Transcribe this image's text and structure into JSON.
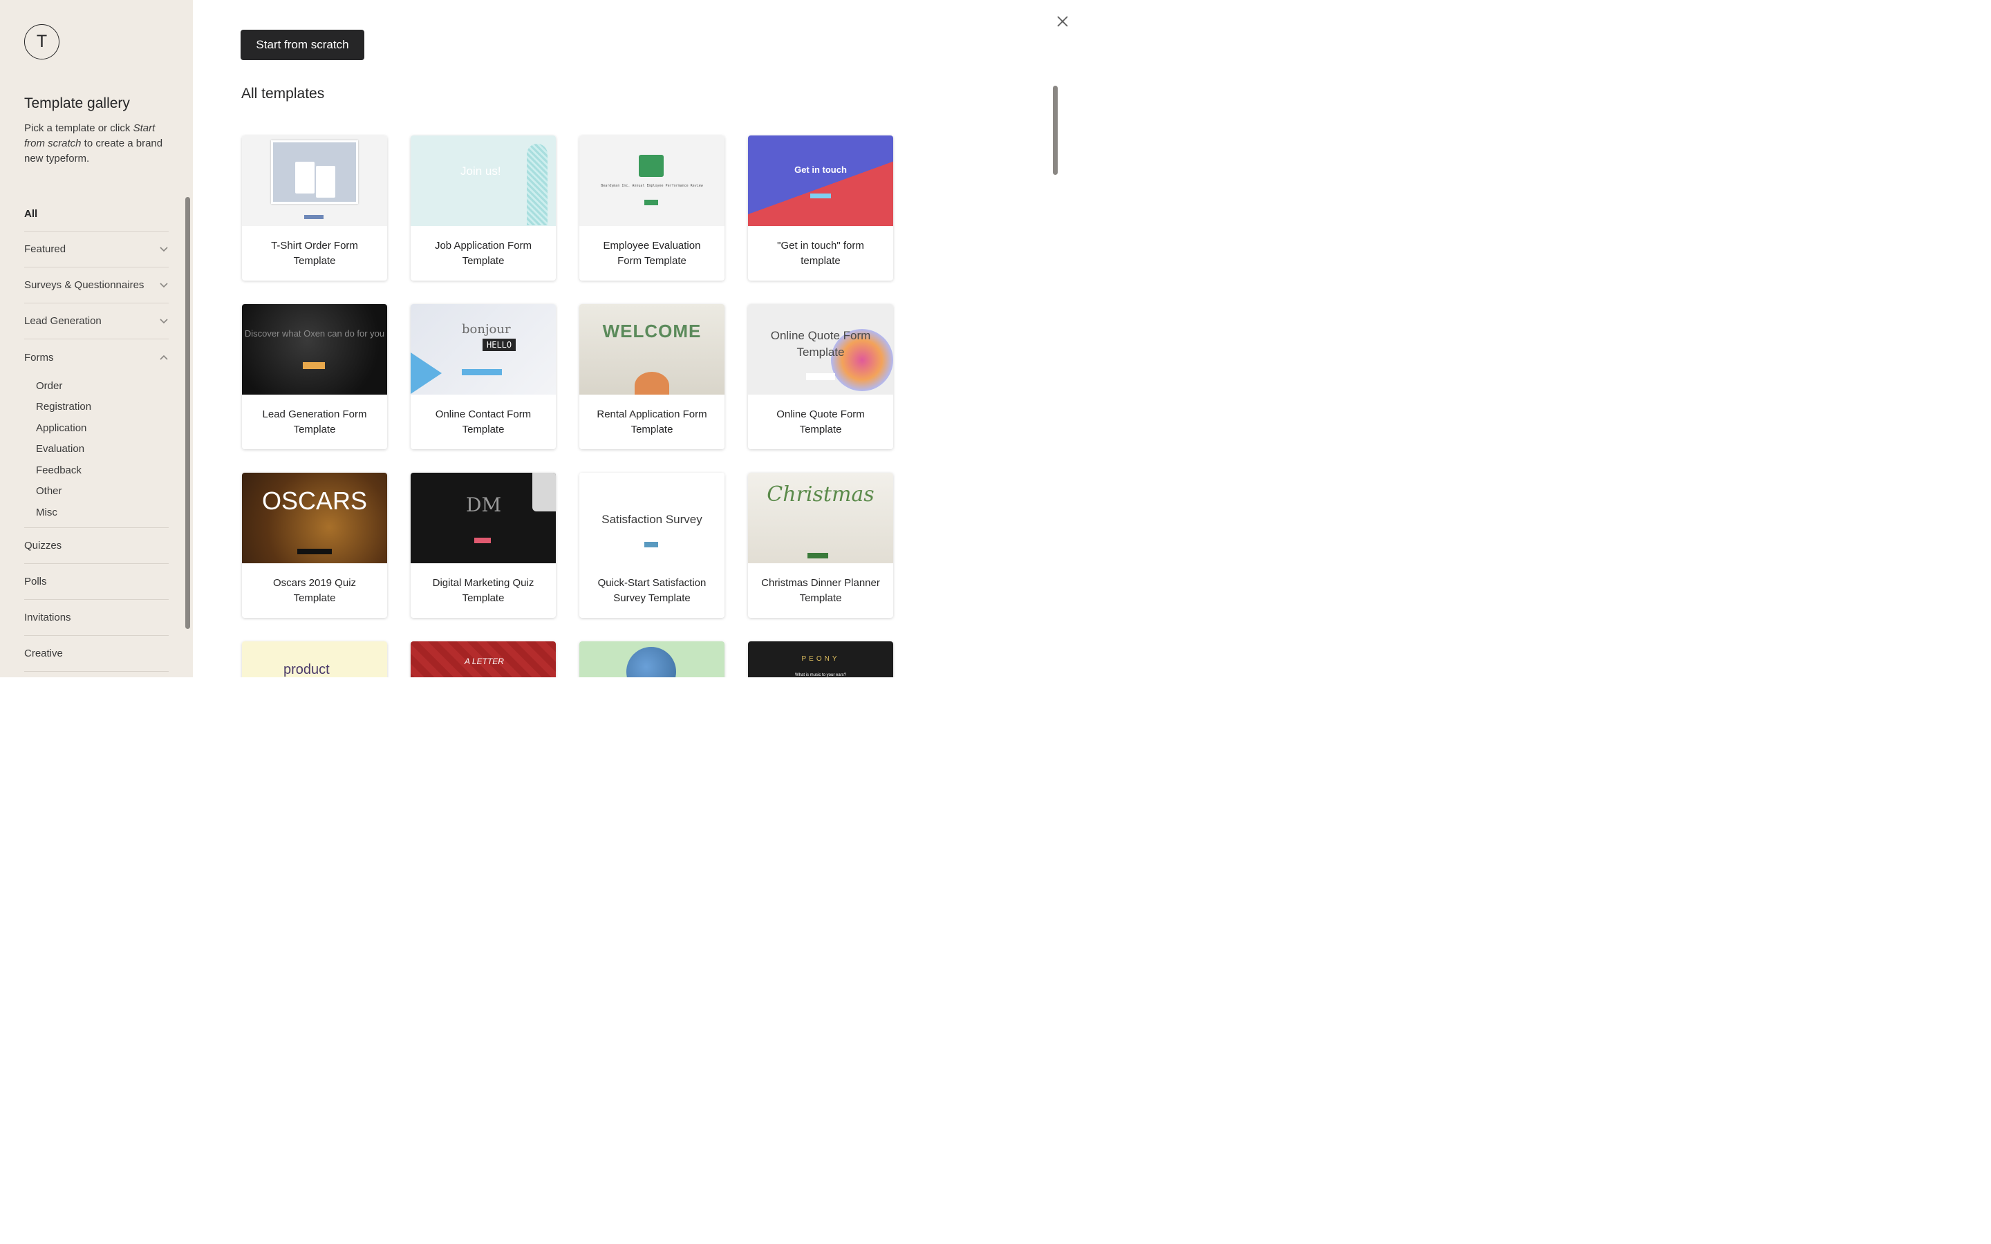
{
  "sidebar": {
    "avatar_letter": "T",
    "title": "Template gallery",
    "description": {
      "part1": "Pick a template or click ",
      "em": "Start from scratch",
      "part2": " to create a brand new typeform."
    },
    "categories": [
      {
        "label": "All",
        "active": true
      },
      {
        "label": "Featured",
        "chevron": "chevron-down"
      },
      {
        "label": "Surveys & Questionnaires",
        "chevron": "chevron-down"
      },
      {
        "label": "Lead Generation",
        "chevron": "chevron-down"
      },
      {
        "label": "Forms",
        "chevron": "chevron-up",
        "expanded": true,
        "subitems": [
          "Order",
          "Registration",
          "Application",
          "Evaluation",
          "Feedback",
          "Other",
          "Misc"
        ]
      },
      {
        "label": "Quizzes"
      },
      {
        "label": "Polls"
      },
      {
        "label": "Invitations"
      },
      {
        "label": "Creative"
      }
    ]
  },
  "main": {
    "start_button": "Start from scratch",
    "section_title": "All templates",
    "close_icon": "close-icon",
    "templates": [
      {
        "name": "T-Shirt Order Form Template",
        "thumb": "t1"
      },
      {
        "name": "Job Application Form Template",
        "thumb": "t2",
        "thumb_text": "Join us!"
      },
      {
        "name": "Employee Evaluation Form Template",
        "thumb": "t3",
        "thumb_text": "Beardyman Inc. Annual Employee Performance Review"
      },
      {
        "name": "\"Get in touch\" form template",
        "thumb": "t4",
        "thumb_text": "Get in touch"
      },
      {
        "name": "Lead Generation Form Template",
        "thumb": "t5",
        "thumb_text": "Discover what Oxen can do for you"
      },
      {
        "name": "Online Contact Form Template",
        "thumb": "t6",
        "thumb_text": "bonjour",
        "thumb_text2": "HELLO"
      },
      {
        "name": "Rental Application Form Template",
        "thumb": "t7",
        "thumb_text": "WELCOME"
      },
      {
        "name": "Online Quote Form Template",
        "thumb": "t8",
        "thumb_text": "Online Quote Form Template"
      },
      {
        "name": "Oscars 2019 Quiz Template",
        "thumb": "t9",
        "thumb_text": "OSCARS"
      },
      {
        "name": "Digital Marketing Quiz Template",
        "thumb": "t10",
        "thumb_text": "DM"
      },
      {
        "name": "Quick-Start Satisfaction Survey Template",
        "thumb": "t11",
        "thumb_text": "Satisfaction Survey"
      },
      {
        "name": "Christmas Dinner Planner Template",
        "thumb": "t12",
        "thumb_text": "Christmas"
      },
      {
        "name": "",
        "thumb": "t13",
        "thumb_text": "product"
      },
      {
        "name": "",
        "thumb": "t14",
        "thumb_text": "A LETTER"
      },
      {
        "name": "",
        "thumb": "t15"
      },
      {
        "name": "",
        "thumb": "t16",
        "thumb_text": "PEONY",
        "thumb_text2": "What is music to your ears?"
      }
    ]
  }
}
